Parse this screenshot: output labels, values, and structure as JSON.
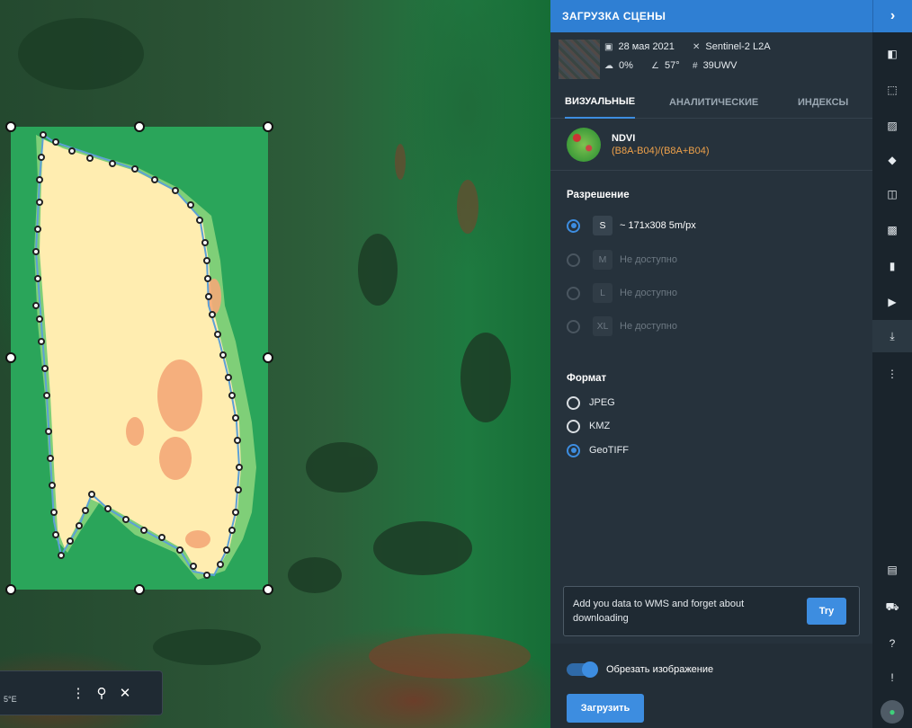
{
  "map": {
    "coordinate_readout": "5°E"
  },
  "panel": {
    "title": "ЗАГРУЗКА СЦЕНЫ",
    "collapse_icon": "chevron-right-icon",
    "scene": {
      "date": "28 мая 2021",
      "satellite": "Sentinel-2 L2A",
      "cloud": "0%",
      "angle": "57°",
      "tile": "39UWV"
    },
    "tabs": [
      {
        "label": "ВИЗУАЛЬНЫЕ",
        "active": true
      },
      {
        "label": "АНАЛИТИЧЕСКИЕ",
        "active": false
      },
      {
        "label": "ИНДЕКСЫ",
        "active": false
      }
    ],
    "layer": {
      "name": "NDVI",
      "formula": "(B8A-B04)/(B8A+B04)"
    },
    "resolution": {
      "title": "Разрешение",
      "options": [
        {
          "size": "S",
          "label": "~ 171x308 5m/px",
          "checked": true,
          "disabled": false
        },
        {
          "size": "M",
          "label": "Не доступно",
          "checked": false,
          "disabled": true
        },
        {
          "size": "L",
          "label": "Не доступно",
          "checked": false,
          "disabled": true
        },
        {
          "size": "XL",
          "label": "Не доступно",
          "checked": false,
          "disabled": true
        }
      ]
    },
    "format": {
      "title": "Формат",
      "options": [
        {
          "label": "JPEG",
          "checked": false
        },
        {
          "label": "KMZ",
          "checked": false
        },
        {
          "label": "GeoTIFF",
          "checked": true
        }
      ]
    },
    "wms": {
      "text": "Add you data to WMS and forget about downloading",
      "button": "Try"
    },
    "crop_label": "Обрезать изображение",
    "load_button": "Загрузить"
  },
  "colors": {
    "accent": "#3d8de0",
    "panel_bg": "#26323c",
    "formula": "#f0a24a"
  }
}
